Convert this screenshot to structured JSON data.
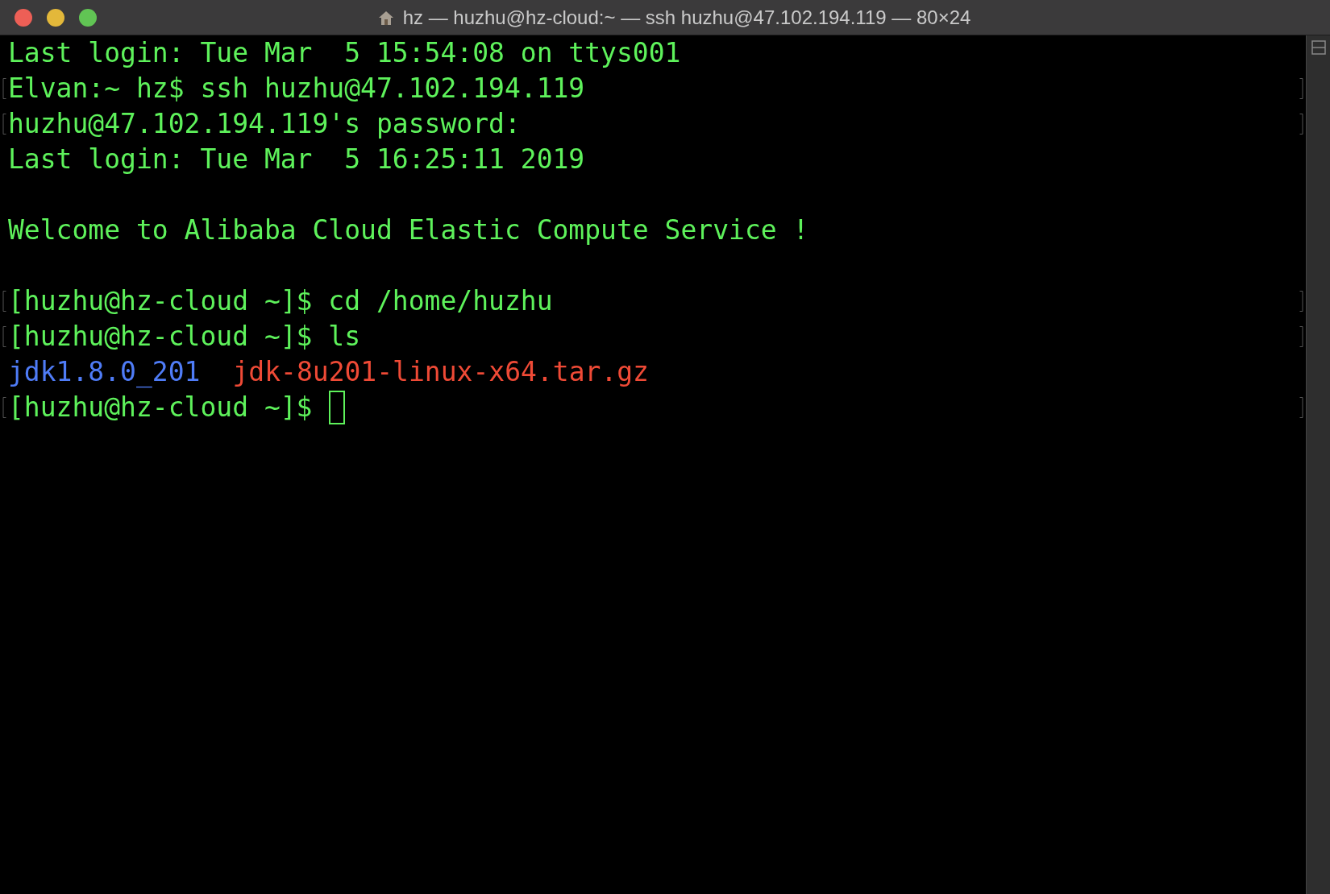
{
  "window": {
    "title": "hz — huzhu@hz-cloud:~ — ssh huzhu@47.102.194.119 — 80×24"
  },
  "lines": [
    {
      "kind": "text",
      "marked": false,
      "segments": [
        {
          "text": "Last login: Tue Mar  5 15:54:08 on ttys001",
          "color": "#5ef25b"
        }
      ]
    },
    {
      "kind": "text",
      "marked": true,
      "segments": [
        {
          "text": "Elvan:~ hz$ ssh huzhu@47.102.194.119",
          "color": "#5ef25b"
        }
      ]
    },
    {
      "kind": "text",
      "marked": true,
      "segments": [
        {
          "text": "huzhu@47.102.194.119's password:",
          "color": "#5ef25b"
        }
      ]
    },
    {
      "kind": "text",
      "marked": false,
      "segments": [
        {
          "text": "Last login: Tue Mar  5 16:25:11 2019",
          "color": "#5ef25b"
        }
      ]
    },
    {
      "kind": "blank"
    },
    {
      "kind": "text",
      "marked": false,
      "segments": [
        {
          "text": "Welcome to Alibaba Cloud Elastic Compute Service !",
          "color": "#5ef25b"
        }
      ]
    },
    {
      "kind": "blank"
    },
    {
      "kind": "text",
      "marked": true,
      "segments": [
        {
          "text": "[huzhu@hz-cloud ~]$ cd /home/huzhu",
          "color": "#5ef25b"
        }
      ]
    },
    {
      "kind": "text",
      "marked": true,
      "segments": [
        {
          "text": "[huzhu@hz-cloud ~]$ ls",
          "color": "#5ef25b"
        }
      ]
    },
    {
      "kind": "text",
      "marked": false,
      "segments": [
        {
          "text": "jdk1.8.0_201",
          "color": "#4f7cf7"
        },
        {
          "text": "jdk-8u201-linux-x64.tar.gz",
          "color": "#ef4a36"
        }
      ]
    },
    {
      "kind": "text",
      "marked": true,
      "cursor": true,
      "segments": [
        {
          "text": "[huzhu@hz-cloud ~]$",
          "color": "#5ef25b"
        }
      ]
    }
  ]
}
